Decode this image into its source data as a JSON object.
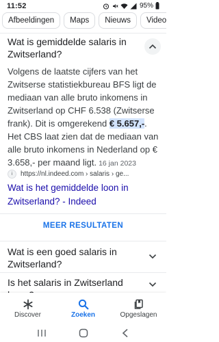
{
  "status_bar": {
    "time": "11:52",
    "battery": "95%",
    "icons": [
      "alarm-icon",
      "mute-icon",
      "wifi-icon",
      "signal-icon",
      "battery-icon"
    ]
  },
  "chips": [
    "Afbeeldingen",
    "Maps",
    "Nieuws",
    "Video's"
  ],
  "expanded_question": {
    "title": "Wat is gemiddelde salaris in Zwitserland?",
    "answer_part1": "Volgens de laatste cijfers van het Zwitserse statistiekbureau BFS ligt de mediaan van alle bruto inkomens in Zwitserland op CHF 6.538 (Zwitserse frank). Dit is omgerekend ",
    "answer_highlight": "€ 5.657,-",
    "answer_part2": ". Het CBS laat zien dat de mediaan van alle bruto inkomens in Nederland op € 3.658,- per maand ligt.",
    "date": "16 jan 2023",
    "source_url": "https://nl.indeed.com › salaris › ge...",
    "source_title": "Wat is het gemiddelde loon in Zwitserland? - Indeed"
  },
  "more_results_label": "MEER RESULTATEN",
  "questions": [
    {
      "title": "Wat is een goed salaris in Zwitserland?"
    },
    {
      "title": "Is het salaris in Zwitserland hoog?"
    }
  ],
  "bottom_nav": [
    {
      "label": "Discover",
      "icon": "asterisk-icon",
      "active": false
    },
    {
      "label": "Zoeken",
      "icon": "search-icon",
      "active": true
    },
    {
      "label": "Opgeslagen",
      "icon": "saved-icon",
      "active": false
    }
  ],
  "colors": {
    "link": "#1a0dab",
    "accent": "#1a73e8",
    "highlight": "#d2e3fc"
  }
}
